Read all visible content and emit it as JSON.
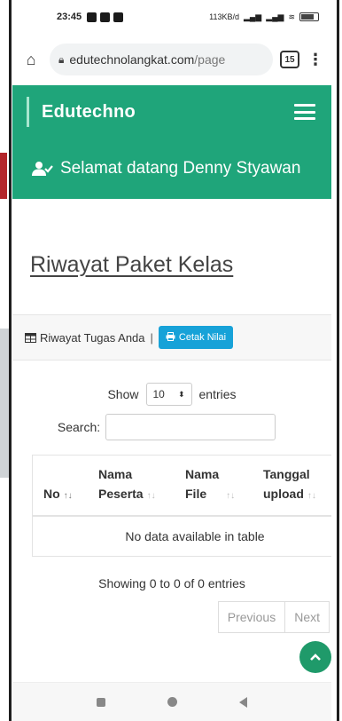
{
  "status_bar": {
    "time": "23:45",
    "network": "113KB/d",
    "battery": "86"
  },
  "browser": {
    "url_domain": "edutechnolangkat.com",
    "url_path": "/page",
    "tab_count": "15"
  },
  "header": {
    "brand": "Edutechno",
    "welcome": "Selamat datang Denny Styawan",
    "color": "#1fa57a"
  },
  "page": {
    "title": "Riwayat Paket Kelas"
  },
  "card": {
    "heading": "Riwayat Tugas Anda",
    "separator": "|",
    "print_button": "Cetak Nilai"
  },
  "datatable": {
    "show_label": "Show",
    "entries_value": "10",
    "entries_label": "entries",
    "search_label": "Search:",
    "columns": [
      {
        "line1": "",
        "line2": "No"
      },
      {
        "line1": "Nama",
        "line2": "Peserta"
      },
      {
        "line1": "Nama",
        "line2": "File"
      },
      {
        "line1": "Tanggal",
        "line2": "upload"
      }
    ],
    "empty_message": "No data available in table",
    "info": "Showing 0 to 0 of 0 entries",
    "pagination": {
      "previous": "Previous",
      "next": "Next"
    }
  }
}
